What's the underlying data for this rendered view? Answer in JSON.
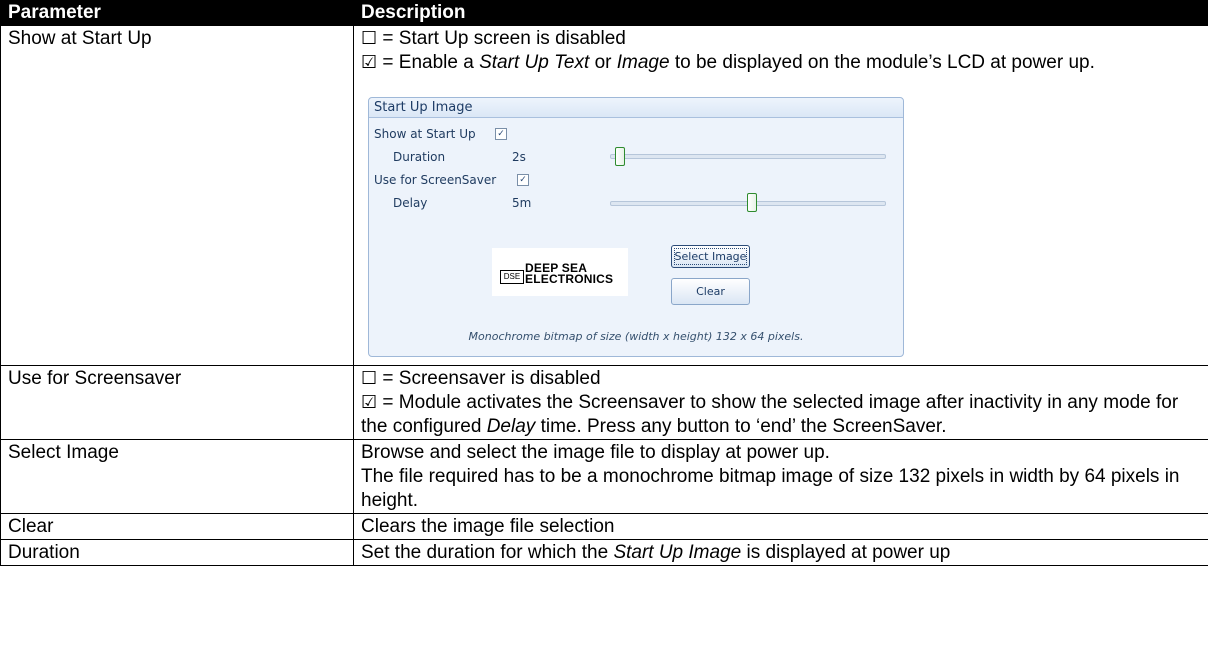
{
  "table": {
    "headers": {
      "parameter": "Parameter",
      "description": "Description"
    },
    "rows": {
      "show_at_startup": {
        "parameter": "Show at Start Up",
        "unchecked_glyph": "☐",
        "unchecked_text": "= Start Up screen is disabled",
        "checked_glyph": "☑",
        "checked_text_1": "= Enable a",
        "checked_em_1": "Start Up Text",
        "checked_text_2": "or",
        "checked_em_2": "Image",
        "checked_text_3": "to be displayed on the module’s LCD at power up."
      },
      "use_for_screensaver": {
        "parameter": "Use for Screensaver",
        "unchecked_glyph": "☐",
        "unchecked_text": "= Screensaver is disabled",
        "checked_glyph": "☑",
        "checked_text_1": "= Module activates the Screensaver to show the selected image after inactivity in any mode for the configured",
        "checked_em": "Delay",
        "checked_text_2": "time. Press any button to ‘end’ the ScreenSaver."
      },
      "select_image": {
        "parameter": "Select Image",
        "line_1": "Browse and select the image file to display at power up.",
        "line_2": "The file required has to be a monochrome bitmap image of size 132 pixels in width by 64 pixels in height."
      },
      "clear": {
        "parameter": "Clear",
        "description": "Clears the image file selection"
      },
      "duration": {
        "parameter": "Duration",
        "text_1": "Set the duration for which the",
        "em": "Start Up Image",
        "text_2": "is displayed at power up"
      }
    }
  },
  "panel": {
    "title": "Start Up Image",
    "show_at_startup_label": "Show at Start Up",
    "show_at_startup_checked": true,
    "duration_label": "Duration",
    "duration_value": "2s",
    "duration_slider_fraction": 0.02,
    "use_for_screensaver_label": "Use for ScreenSaver",
    "use_for_screensaver_checked": true,
    "delay_label": "Delay",
    "delay_value": "5m",
    "delay_slider_fraction": 0.52,
    "checkmark_glyph": "✓",
    "logo": {
      "mark": "DSE",
      "line_1": "DEEP SEA",
      "line_2": "ELECTRONICS"
    },
    "select_image_button": "Select Image",
    "clear_button": "Clear",
    "caption": "Monochrome bitmap of size (width x height) 132 x 64 pixels."
  }
}
